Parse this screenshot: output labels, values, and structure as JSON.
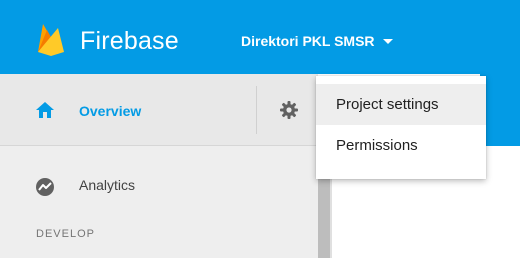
{
  "header": {
    "brand": "Firebase",
    "project_name": "Direktori PKL SMSR",
    "brand_color": "#039be5",
    "logo_color": "#ffc107"
  },
  "sidebar": {
    "overview_label": "Overview",
    "overview_icon": "home-icon",
    "settings_icon": "gear-icon",
    "items": [
      {
        "label": "Analytics",
        "icon": "analytics-icon"
      }
    ],
    "section_label": "DEVELOP"
  },
  "settings_menu": {
    "items": [
      {
        "label": "Project settings",
        "hovered": true
      },
      {
        "label": "Permissions",
        "hovered": false
      }
    ]
  }
}
